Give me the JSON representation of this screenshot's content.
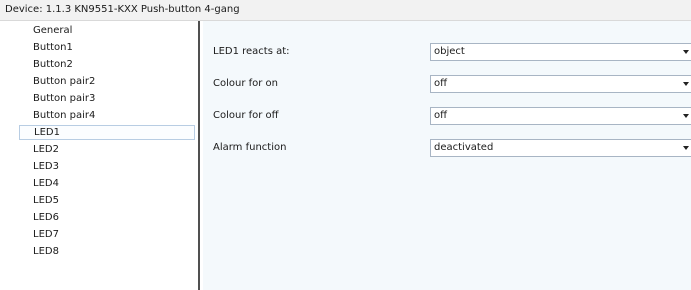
{
  "window": {
    "title": "Device: 1.1.3  KN9551-KXX Push-button 4-gang"
  },
  "sidebar": {
    "items": [
      {
        "label": "General",
        "selected": false
      },
      {
        "label": "Button1",
        "selected": false
      },
      {
        "label": "Button2",
        "selected": false
      },
      {
        "label": "Button pair2",
        "selected": false
      },
      {
        "label": "Button pair3",
        "selected": false
      },
      {
        "label": "Button pair4",
        "selected": false
      },
      {
        "label": "LED1",
        "selected": true
      },
      {
        "label": "LED2",
        "selected": false
      },
      {
        "label": "LED3",
        "selected": false
      },
      {
        "label": "LED4",
        "selected": false
      },
      {
        "label": "LED5",
        "selected": false
      },
      {
        "label": "LED6",
        "selected": false
      },
      {
        "label": "LED7",
        "selected": false
      },
      {
        "label": "LED8",
        "selected": false
      }
    ]
  },
  "parameters": [
    {
      "label": "LED1 reacts at:",
      "value": "object"
    },
    {
      "label": "Colour for on",
      "value": "off"
    },
    {
      "label": "Colour for off",
      "value": "off"
    },
    {
      "label": "Alarm function",
      "value": "deactivated"
    }
  ],
  "icons": {
    "dropdown_arrow": "chevron-down-icon"
  }
}
